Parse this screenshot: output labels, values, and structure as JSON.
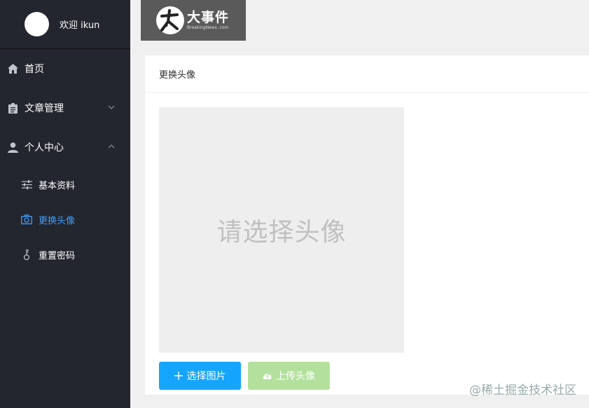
{
  "sidebar": {
    "welcome": "欢迎 ikun",
    "items": [
      {
        "label": "首页",
        "icon": "home-icon"
      },
      {
        "label": "文章管理",
        "icon": "clipboard-icon"
      },
      {
        "label": "个人中心",
        "icon": "user-icon"
      }
    ],
    "sub_items": [
      {
        "label": "基本资料",
        "icon": "sliders-icon"
      },
      {
        "label": "更换头像",
        "icon": "camera-icon",
        "active": true
      },
      {
        "label": "重置密码",
        "icon": "key-icon"
      }
    ],
    "active_color": "#409eff"
  },
  "logo": {
    "cn": "大事件",
    "en": "BreakingNews .com"
  },
  "card": {
    "title": "更换头像",
    "preview_text": "请选择头像",
    "select_button": "选择图片",
    "upload_button": "上传头像"
  },
  "watermark": "@稀土掘金技术社区"
}
